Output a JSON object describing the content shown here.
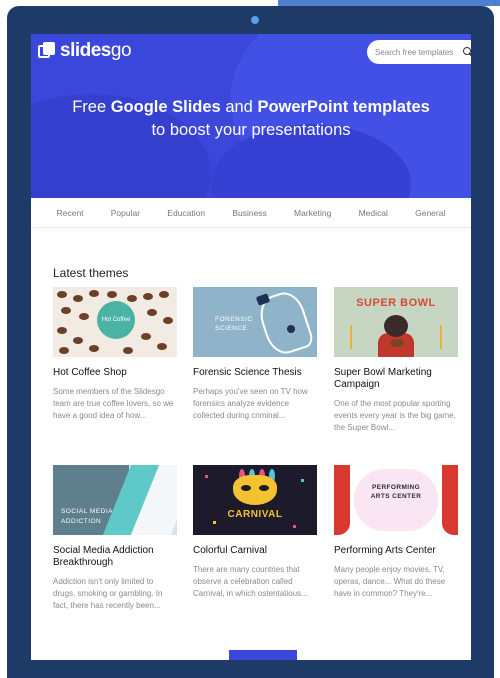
{
  "header": {
    "logo_text": "slides",
    "logo_text_suffix": "go",
    "search_placeholder": "Search free templates"
  },
  "hero": {
    "line1_pre": "Free ",
    "line1_b1": "Google Slides",
    "line1_mid": " and ",
    "line1_b2": "PowerPoint templates",
    "line2": "to boost your presentations"
  },
  "nav": {
    "items": [
      "Recent",
      "Popular",
      "Education",
      "Business",
      "Marketing",
      "Medical",
      "General"
    ]
  },
  "section": {
    "title_b": "Latest themes"
  },
  "cards": [
    {
      "title": "Hot Coffee Shop",
      "desc": "Some members of the Slidesgo team are true coffee lovers, so we have a good idea of how...",
      "thumb_text": "Hot Coffee"
    },
    {
      "title": "Forensic Science Thesis",
      "desc": "Perhaps you've seen on TV how forensics analyze evidence collected during criminal...",
      "thumb_text_1": "FORENSIC",
      "thumb_text_2": "SCIENCE"
    },
    {
      "title": "Super Bowl Marketing Campaign",
      "desc": "One of the most popular sporting events every year is the big game, the Super Bowl...",
      "thumb_text": "SUPER BOWL"
    },
    {
      "title": "Social Media Addiction Breakthrough",
      "desc": "Addiction isn't only limited to drugs, smoking or gambling. In fact, there has recently been...",
      "thumb_text_1": "SOCIAL MEDIA",
      "thumb_text_2": "ADDICTION"
    },
    {
      "title": "Colorful Carnival",
      "desc": "There are many countries that observe a celebration called Carnival, in which ostentatious...",
      "thumb_text": "CARNIVAL"
    },
    {
      "title": "Performing Arts Center",
      "desc": "Many people enjoy movies, TV, operas, dance... What do these have in common? They're...",
      "thumb_text_1": "PERFORMING",
      "thumb_text_2": "ARTS CENTER"
    }
  ],
  "colors": {
    "brand": "#3b46db",
    "frame": "#1e3a66"
  }
}
